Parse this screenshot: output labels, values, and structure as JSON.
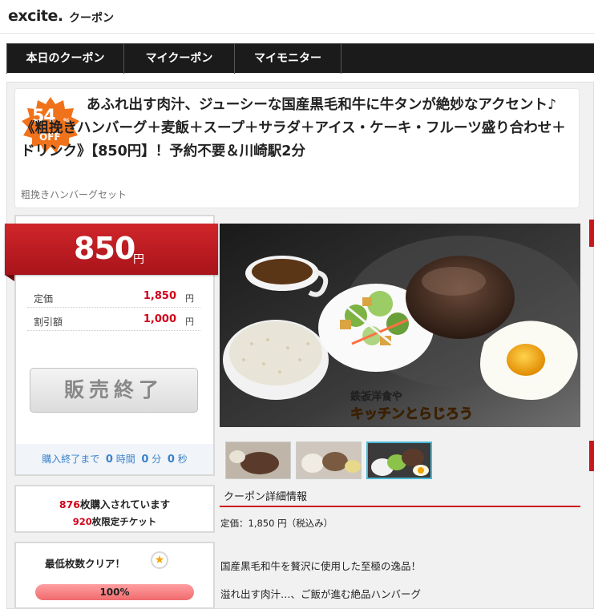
{
  "header": {
    "logo_main": "excite.",
    "logo_sub": "クーポン"
  },
  "nav": [
    {
      "label": "本日のクーポン"
    },
    {
      "label": "マイクーポン"
    },
    {
      "label": "マイモニター"
    }
  ],
  "deal": {
    "discount_number": "54",
    "discount_pct": "%",
    "discount_off": "OFF",
    "title": "あふれ出す肉汁、ジューシーな国産黒毛和牛に牛タンが絶妙なアクセント♪《粗挽きハンバーグ＋麦飯＋スープ＋サラダ＋アイス・ケーキ・フルーツ盛り合わせ＋ドリンク》【850円】！予約不要＆川崎駅2分",
    "subtitle": "粗挽きハンバーグセット"
  },
  "price": {
    "value": "850",
    "unit": "円",
    "rows": [
      {
        "label": "定価",
        "value": "1,850",
        "unit": "円"
      },
      {
        "label": "割引額",
        "value": "1,000",
        "unit": "円"
      }
    ],
    "sold_out_label": "販売終了",
    "timer": {
      "prefix": "購入終了まで",
      "hours": "0",
      "hours_unit": "時間",
      "minutes": "0",
      "minutes_unit": "分",
      "seconds": "0",
      "seconds_unit": "秒"
    }
  },
  "purchase": {
    "count": "876",
    "count_suffix": "枚購入されています",
    "limit": "920",
    "limit_suffix": "枚限定チケット"
  },
  "minimum": {
    "label": "最低枚数クリア！",
    "progress_text": "100%",
    "progress_fraction": 1.0
  },
  "image": {
    "overlay_line1": "鉄板洋食や",
    "overlay_line2": "キッチンとらじろう"
  },
  "details": {
    "heading": "クーポン詳細情報",
    "price_line": "定価：1,850 円（税込み）",
    "para1": "国産黒毛和牛を贅沢に使用した至極の逸品！",
    "para2": "溢れ出す肉汁…、ご飯が進む絶品ハンバーグ"
  },
  "colors": {
    "accent_red": "#c8161d",
    "badge_orange": "#f0731c",
    "timer_blue": "#3a82cc",
    "nav_bg": "#1b1b1b"
  }
}
